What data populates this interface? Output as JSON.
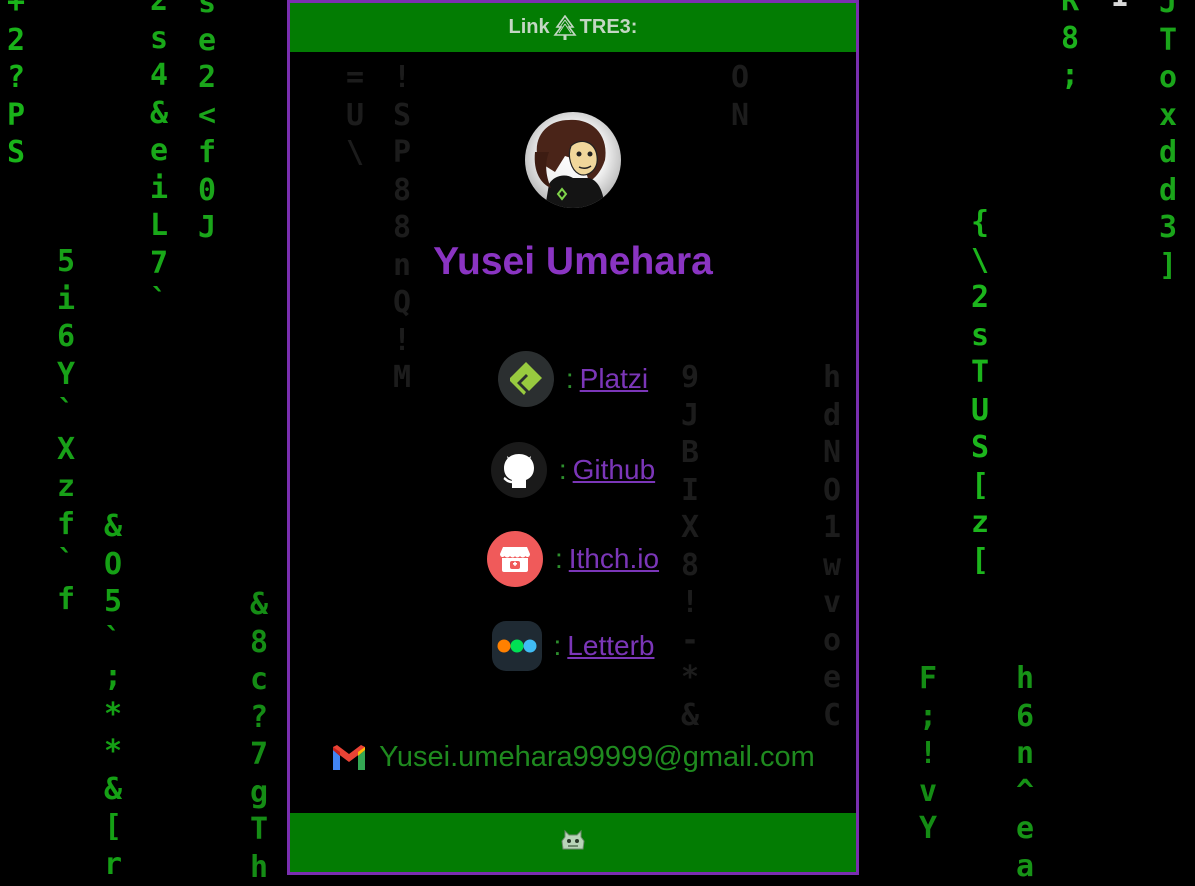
{
  "header": {
    "title_prefix": "Link",
    "title_suffix": "TRE3:"
  },
  "profile": {
    "name": "Yusei Umehara"
  },
  "links": [
    {
      "id": "platzi",
      "label": "Platzi",
      "separator": ":",
      "icon": "platzi-icon"
    },
    {
      "id": "github",
      "label": "Github",
      "separator": ":",
      "icon": "github-icon"
    },
    {
      "id": "itch",
      "label": "Ithch.io",
      "separator": ":",
      "icon": "itchio-icon"
    },
    {
      "id": "letterboxd",
      "label": "Letterb",
      "separator": ":",
      "icon": "letterboxd-icon"
    }
  ],
  "email": {
    "address": "Yusei.umehara99999@gmail.com",
    "icon": "gmail-icon"
  },
  "footer": {
    "icon": "robot-icon"
  },
  "background_rain": [
    {
      "chars": [
        "+",
        "2",
        "?",
        "P",
        "S"
      ],
      "color": "#19b319"
    },
    {
      "chars": [
        "5",
        "i",
        "6",
        "Y",
        "`",
        "X",
        "z",
        "f",
        "`",
        "f"
      ],
      "color": "#18a018"
    },
    {
      "chars": [
        "&",
        "O",
        "5",
        "`",
        ";",
        "*",
        "*",
        "&",
        "[",
        "r"
      ],
      "color": "#15a015"
    },
    {
      "chars": [
        "2",
        "s",
        "4",
        "&",
        "e",
        "i",
        "L",
        "7",
        "`"
      ],
      "color": "#19a819"
    },
    {
      "chars": [
        "s",
        "e",
        "2",
        "<",
        "f",
        "0",
        "J"
      ],
      "color": "#1aa51a"
    },
    {
      "chars": [
        "&",
        "8",
        "c",
        "?",
        "7",
        "g",
        "T",
        "h"
      ],
      "color": "#158c15"
    },
    {
      "chars": [
        "R",
        "8",
        ";"
      ],
      "color": "#1cb01c"
    },
    {
      "chars": [
        "I"
      ],
      "color": "#d8d8d8"
    },
    {
      "chars": [
        "{",
        "\\",
        "2",
        "s",
        "T",
        "U",
        "S",
        "[",
        "z",
        "["
      ],
      "color": "#1cb51c"
    },
    {
      "chars": [
        "J",
        "T",
        "o",
        "x",
        "d",
        "d",
        "3",
        "]"
      ],
      "color": "#1aa51a"
    },
    {
      "chars": [
        "F",
        ";",
        "!",
        "v",
        "Y"
      ],
      "color": "#148c14"
    },
    {
      "chars": [
        "h",
        "6",
        "n",
        "^",
        "e",
        "a"
      ],
      "color": "#179417"
    }
  ],
  "ghost_rain": [
    {
      "chars": [
        "=",
        "U",
        "\\"
      ]
    },
    {
      "chars": [
        "!",
        "S",
        "P",
        "8",
        "8",
        "n",
        "Q",
        "!",
        "M"
      ]
    },
    {
      "chars": [
        "O",
        "N"
      ]
    },
    {
      "chars": [
        "9",
        "J",
        "B",
        "I",
        "X",
        "8",
        "!",
        "-",
        "*",
        "&"
      ]
    },
    {
      "chars": [
        "h",
        "d",
        "N",
        "O",
        "1",
        "w",
        "v",
        "o",
        "e",
        "C"
      ]
    }
  ]
}
